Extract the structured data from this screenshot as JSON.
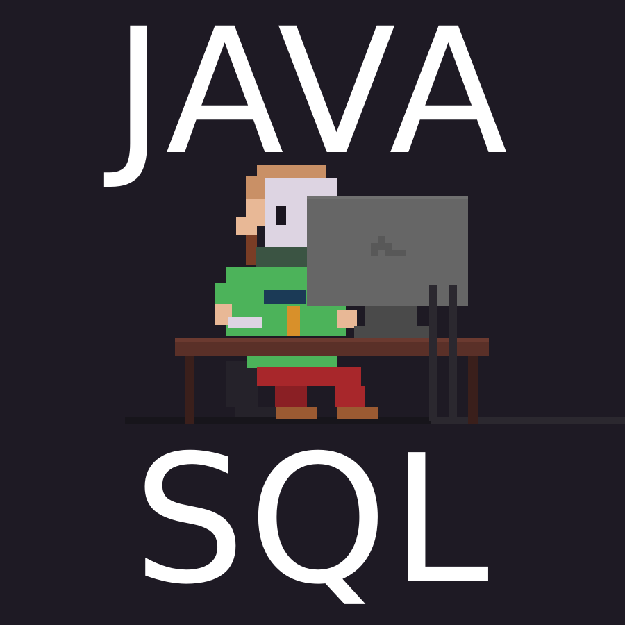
{
  "title_top": "JAVA",
  "title_bottom": "SQL",
  "colors": {
    "background": "#1e1a24",
    "text": "#ffffff",
    "hair": "#c99066",
    "skin": "#e8b896",
    "mask": "#ddd4e2",
    "beard": "#3b5443",
    "shirt": "#4cb35a",
    "pants": "#a8272b",
    "desk": "#5a3028",
    "monitor": "#666666"
  },
  "icons": [
    "programmer-figure",
    "desk",
    "monitor",
    "chair",
    "floor-line"
  ]
}
